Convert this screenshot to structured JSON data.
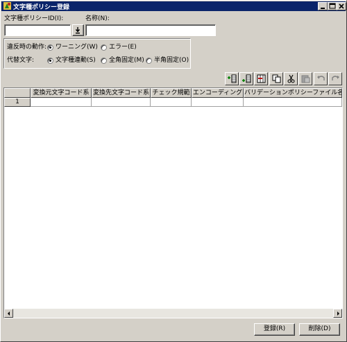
{
  "window": {
    "title": "文字種ポリシー登録"
  },
  "form": {
    "policy_id_label": "文字種ポリシーID(I):",
    "policy_id_value": "",
    "name_label": "名称(N):",
    "name_value": ""
  },
  "options": {
    "violation_label": "違反時の動作:",
    "violation_options": [
      "ワーニング(W)",
      "エラー(E)"
    ],
    "violation_selected": "ワーニング(W)",
    "substitute_label": "代替文字:",
    "substitute_options": [
      "文字種連動(S)",
      "全角固定(M)",
      "半角固定(O)"
    ],
    "substitute_selected": "文字種連動(S)"
  },
  "toolbar": {
    "icons": [
      "insert-row-above-icon",
      "insert-row-below-icon",
      "insert-column-icon",
      "copy-icon",
      "cut-icon",
      "paste-icon",
      "undo-icon",
      "redo-icon"
    ]
  },
  "table": {
    "columns": [
      "変換元文字コード系",
      "変換先文字コード系",
      "チェック規範",
      "エンコーディング",
      "バリデーションポリシーファイル名"
    ],
    "rows": [
      {
        "num": "1",
        "cells": [
          "",
          "",
          "",
          "",
          ""
        ]
      }
    ]
  },
  "buttons": {
    "register": "登録(R)",
    "delete": "削除(D)"
  },
  "colors": {
    "titlebar": "#0a246a",
    "face": "#d4d0c8",
    "window_bg": "#ffffff"
  }
}
